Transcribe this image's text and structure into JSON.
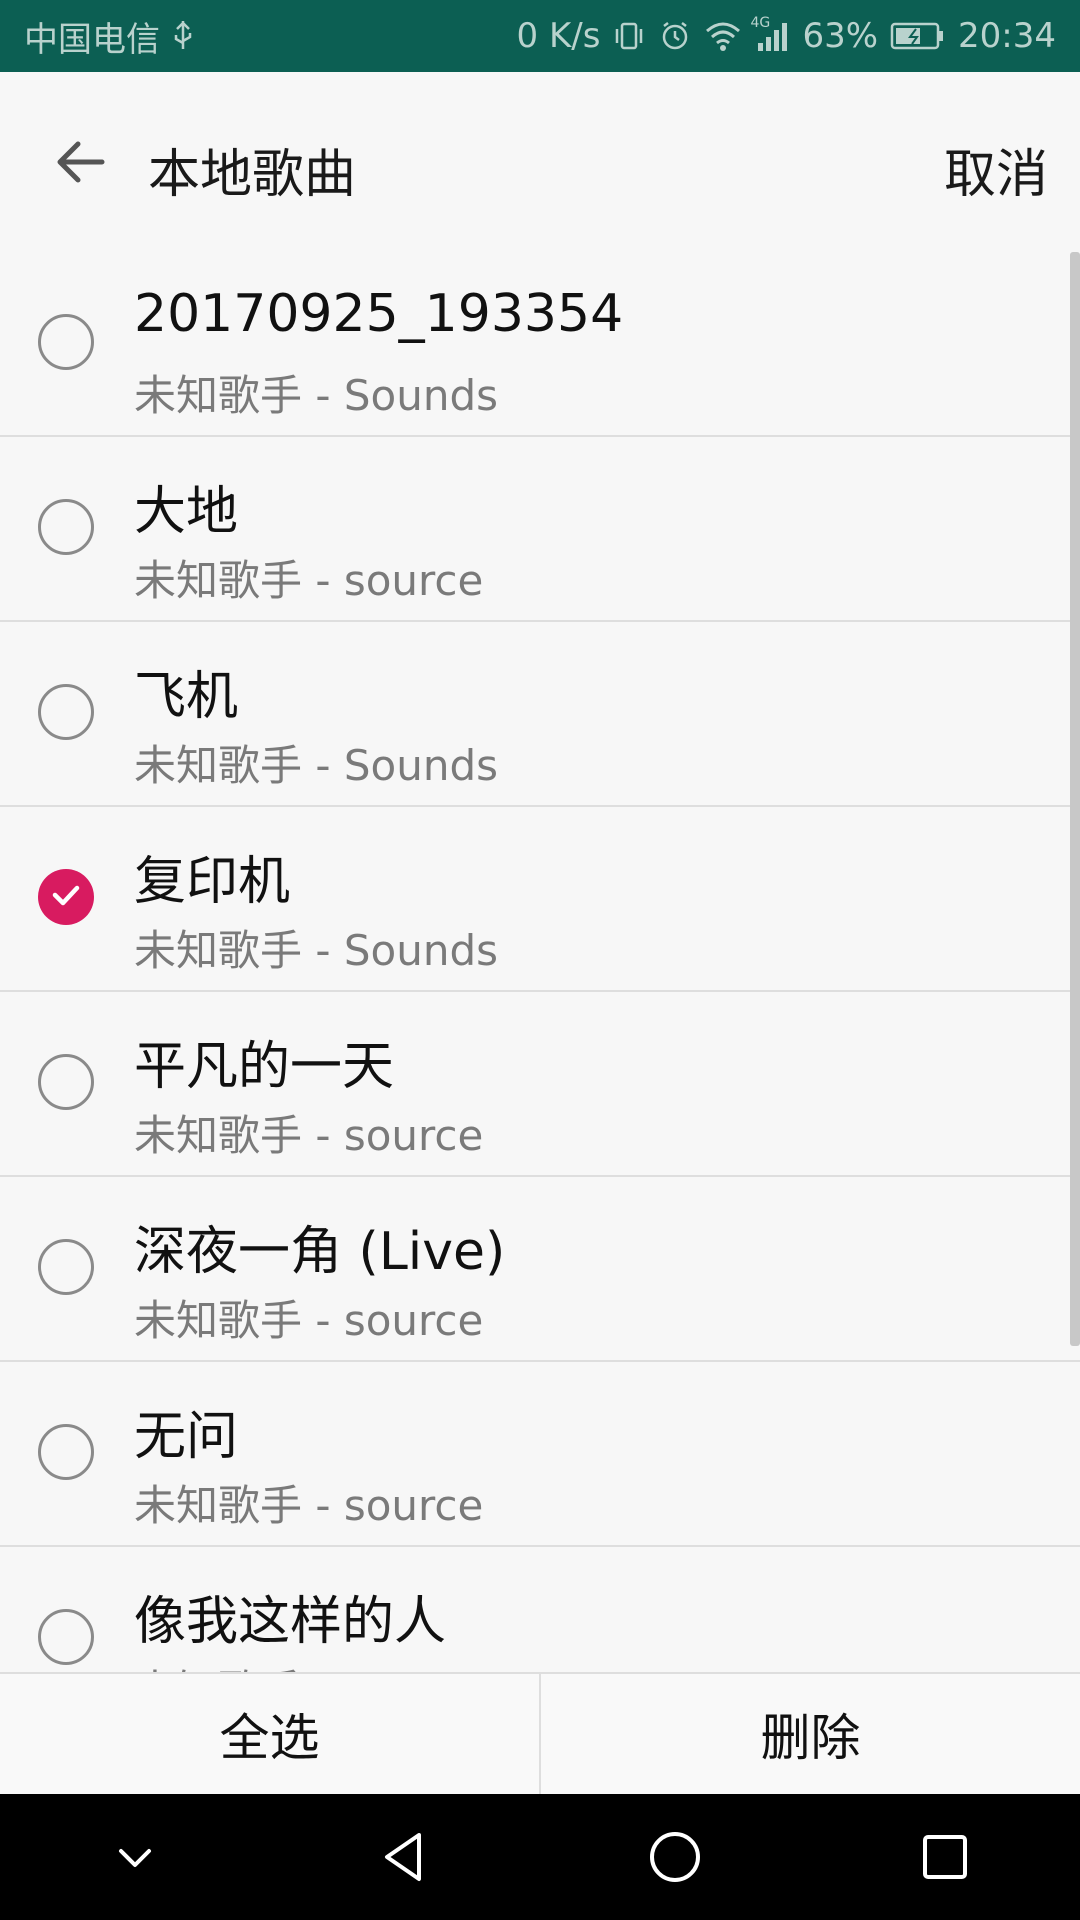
{
  "status_bar": {
    "carrier": "中国电信",
    "net_speed": "0 K/s",
    "network_type": "4G",
    "battery": "63%",
    "time": "20:34",
    "icons": [
      "usb-icon",
      "vibrate-icon",
      "alarm-icon",
      "wifi-icon",
      "signal-icon",
      "battery-charging-icon"
    ]
  },
  "header": {
    "title": "本地歌曲",
    "cancel_label": "取消",
    "back_icon": "back-arrow-icon"
  },
  "songs": [
    {
      "title": "20170925_193354",
      "subtitle": "未知歌手 - Sounds",
      "checked": false
    },
    {
      "title": "大地",
      "subtitle": "未知歌手 - source",
      "checked": false
    },
    {
      "title": "飞机",
      "subtitle": "未知歌手 - Sounds",
      "checked": false
    },
    {
      "title": "复印机",
      "subtitle": "未知歌手 - Sounds",
      "checked": true
    },
    {
      "title": "平凡的一天",
      "subtitle": "未知歌手 - source",
      "checked": false
    },
    {
      "title": "深夜一角 (Live)",
      "subtitle": "未知歌手 - source",
      "checked": false
    },
    {
      "title": "无问",
      "subtitle": "未知歌手 - source",
      "checked": false
    },
    {
      "title": "像我这样的人",
      "subtitle": "未知歌手 - source",
      "checked": false
    }
  ],
  "actions": {
    "select_all_label": "全选",
    "delete_label": "删除"
  },
  "nav": {
    "icons": [
      "collapse-icon",
      "back-triangle-icon",
      "home-circle-icon",
      "recents-square-icon"
    ]
  },
  "colors": {
    "status_bar": "#0c5f53",
    "accent_checked": "#d81b60",
    "background": "#f7f7f7"
  }
}
